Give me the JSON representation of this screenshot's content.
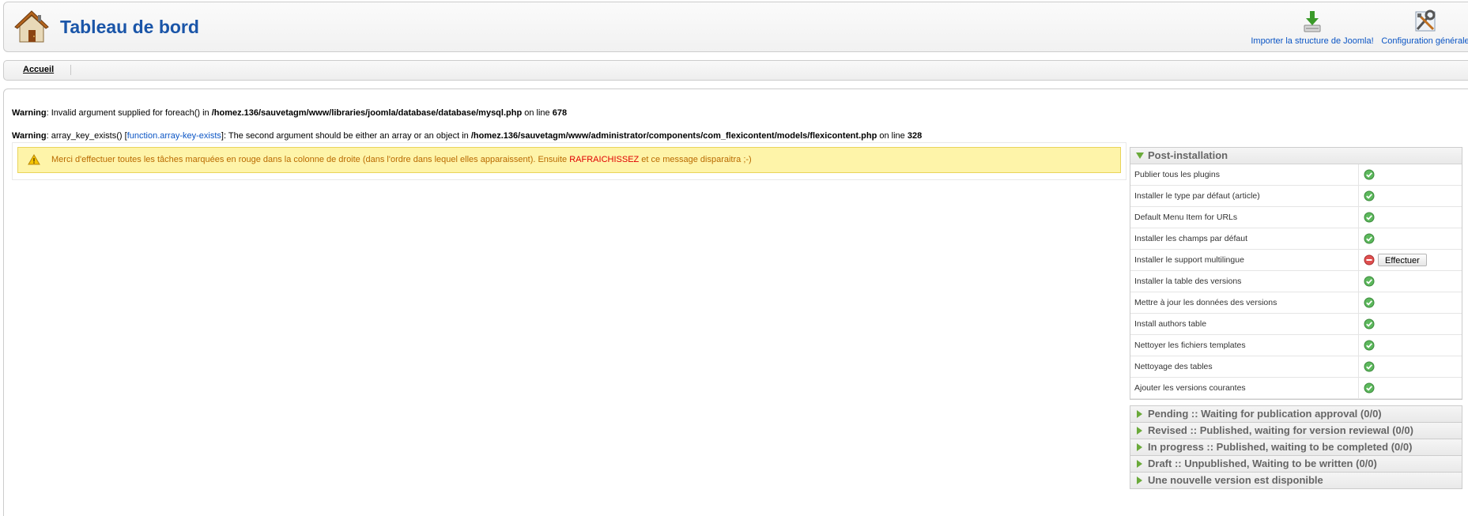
{
  "header": {
    "title": "Tableau de bord",
    "buttons": {
      "import_label": "Importer la structure de Joomla!",
      "config_label": "Configuration générale"
    }
  },
  "submenu": {
    "items": [
      "Accueil"
    ]
  },
  "warnings": [
    {
      "prefix": "Warning",
      "text_before": ": Invalid argument supplied for foreach() in ",
      "path": "/homez.136/sauvetagm/www/libraries/joomla/database/database/mysql.php",
      "on_line": " on line ",
      "line": "678"
    },
    {
      "prefix": "Warning",
      "text_before": ": array_key_exists() [",
      "link": "function.array-key-exists",
      "text_mid": "]: The second argument should be either an array or an object in ",
      "path": "/homez.136/sauvetagm/www/administrator/components/com_flexicontent/models/flexicontent.php",
      "on_line": " on line ",
      "line": "328"
    }
  ],
  "notice": {
    "text_before": "Merci d'effectuer toutes les tâches marquées en rouge dans la colonne de droite (dans l'ordre dans lequel elles apparaissent). Ensuite ",
    "highlight": "RAFRAICHISSEZ",
    "text_after": " et ce message disparaitra ;-)"
  },
  "post_installation": {
    "title": "Post-installation",
    "action_label": "Effectuer",
    "tasks": [
      {
        "label": "Publier tous les plugins",
        "status": "ok"
      },
      {
        "label": "Installer le type par défaut (article)",
        "status": "ok"
      },
      {
        "label": "Default Menu Item for URLs",
        "status": "ok"
      },
      {
        "label": "Installer les champs par défaut",
        "status": "ok"
      },
      {
        "label": "Installer le support multilingue",
        "status": "pending"
      },
      {
        "label": "Installer la table des versions",
        "status": "ok"
      },
      {
        "label": "Mettre à jour les données des versions",
        "status": "ok"
      },
      {
        "label": "Install authors table",
        "status": "ok"
      },
      {
        "label": "Nettoyer les fichiers templates",
        "status": "ok"
      },
      {
        "label": "Nettoyage des tables",
        "status": "ok"
      },
      {
        "label": "Ajouter les versions courantes",
        "status": "ok"
      }
    ]
  },
  "collapsed_panels": [
    "Pending :: Waiting for publication approval (0/0)",
    "Revised :: Published, waiting for version reviewal (0/0)",
    "In progress :: Published, waiting to be completed (0/0)",
    "Draft :: Unpublished, Waiting to be written (0/0)",
    "Une nouvelle version est disponible"
  ],
  "colors": {
    "title_blue": "#1a55a8",
    "link_blue": "#0b55c4",
    "ok_green": "#5cb85c",
    "error_red": "#e05050",
    "notice_bg": "#fef4a9",
    "notice_text": "#b96a00"
  }
}
